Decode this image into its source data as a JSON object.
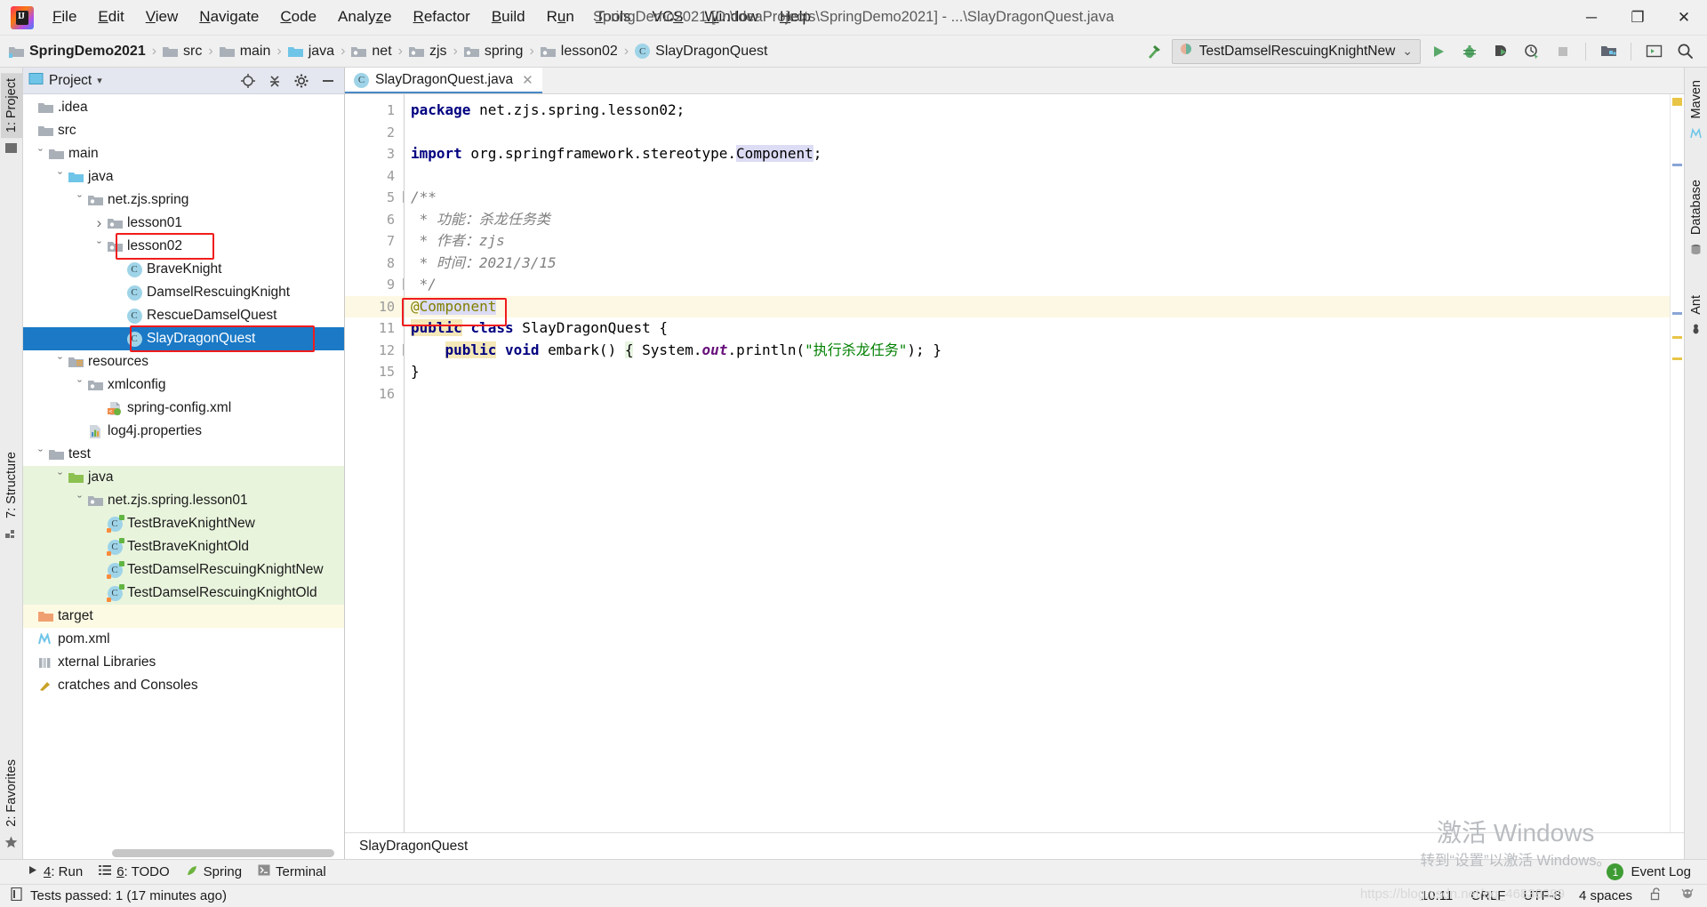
{
  "titlebar": {
    "window_title": "SpringDemo2021 [D:\\IdeaProjects\\SpringDemo2021] - ...\\SlayDragonQuest.java",
    "logo_text": "IJ",
    "menu": [
      {
        "label": "File"
      },
      {
        "label": "Edit"
      },
      {
        "label": "View"
      },
      {
        "label": "Navigate"
      },
      {
        "label": "Code"
      },
      {
        "label": "Analyze"
      },
      {
        "label": "Refactor"
      },
      {
        "label": "Build"
      },
      {
        "label": "Run"
      },
      {
        "label": "Tools"
      },
      {
        "label": "VCS"
      },
      {
        "label": "Window"
      },
      {
        "label": "Help"
      }
    ],
    "minimize": "─",
    "maximize": "❐",
    "close": "✕"
  },
  "navbar": {
    "breadcrumbs": [
      {
        "label": "SpringDemo2021",
        "icon": "project-folder-icon"
      },
      {
        "label": "src",
        "icon": "folder-icon"
      },
      {
        "label": "main",
        "icon": "folder-icon"
      },
      {
        "label": "java",
        "icon": "source-folder-icon"
      },
      {
        "label": "net",
        "icon": "package-icon"
      },
      {
        "label": "zjs",
        "icon": "package-icon"
      },
      {
        "label": "spring",
        "icon": "package-icon"
      },
      {
        "label": "lesson02",
        "icon": "package-icon"
      },
      {
        "label": "SlayDragonQuest",
        "icon": "class-icon"
      }
    ],
    "separator": "›",
    "run_configuration": "TestDamselRescuingKnightNew",
    "run_config_dropdown": "⌄",
    "toolbar_icons": [
      "build-hammer-icon",
      "run-icon",
      "debug-icon",
      "run-coverage-icon",
      "profiler-icon",
      "stop-icon",
      "project-structure-icon",
      "terminal-icon",
      "search-everywhere-icon"
    ]
  },
  "left_strip": {
    "tabs": [
      {
        "label": "1: Project",
        "selected": true
      },
      {
        "label": "7: Structure",
        "selected": false
      },
      {
        "label": "2: Favorites",
        "selected": false
      }
    ]
  },
  "right_strip": {
    "tabs": [
      {
        "label": "Maven"
      },
      {
        "label": "Database"
      },
      {
        "label": "Ant"
      }
    ]
  },
  "project_panel": {
    "title": "Project",
    "dropdown": "▾",
    "header_icons": [
      "locate-target-icon",
      "collapse-all-icon",
      "settings-gear-icon",
      "hide-panel-icon"
    ],
    "tree": [
      {
        "label": ".idea",
        "depth": 0,
        "arrow": "",
        "icon": "folder-icon",
        "color": "#a9b0b8",
        "state": "none"
      },
      {
        "label": "src",
        "depth": 0,
        "arrow": "",
        "icon": "folder-icon",
        "color": "#a9b0b8",
        "state": "none"
      },
      {
        "label": "main",
        "depth": 1,
        "arrow": "ˇ",
        "icon": "folder-icon",
        "color": "#a9b0b8",
        "state": "none"
      },
      {
        "label": "java",
        "depth": 2,
        "arrow": "ˇ",
        "icon": "source-folder-icon",
        "color": "#6fc5e8",
        "state": "none"
      },
      {
        "label": "net.zjs.spring",
        "depth": 3,
        "arrow": "ˇ",
        "icon": "package-icon",
        "color": "#a9b0b8",
        "state": "none"
      },
      {
        "label": "lesson01",
        "depth": 4,
        "arrow": "›",
        "icon": "package-icon",
        "color": "#a9b0b8",
        "state": "none"
      },
      {
        "label": "lesson02",
        "depth": 4,
        "arrow": "ˇ",
        "icon": "package-icon",
        "color": "#a9b0b8",
        "state": "highlight"
      },
      {
        "label": "BraveKnight",
        "depth": 5,
        "arrow": "",
        "icon": "class-icon",
        "color": "#9fd4e8",
        "state": "none"
      },
      {
        "label": "DamselRescuingKnight",
        "depth": 5,
        "arrow": "",
        "icon": "class-icon",
        "color": "#9fd4e8",
        "state": "none"
      },
      {
        "label": "RescueDamselQuest",
        "depth": 5,
        "arrow": "",
        "icon": "class-icon",
        "color": "#9fd4e8",
        "state": "none"
      },
      {
        "label": "SlayDragonQuest",
        "depth": 5,
        "arrow": "",
        "icon": "class-icon",
        "color": "#9fd4e8",
        "state": "selected-highlight"
      },
      {
        "label": "resources",
        "depth": 2,
        "arrow": "ˇ",
        "icon": "resource-folder-icon",
        "color": "#a9b0b8",
        "state": "none"
      },
      {
        "label": "xmlconfig",
        "depth": 3,
        "arrow": "ˇ",
        "icon": "package-icon",
        "color": "#a9b0b8",
        "state": "none"
      },
      {
        "label": "spring-config.xml",
        "depth": 4,
        "arrow": "",
        "icon": "spring-xml-icon",
        "color": "#6db33f",
        "state": "none"
      },
      {
        "label": "log4j.properties",
        "depth": 3,
        "arrow": "",
        "icon": "properties-icon",
        "color": "#e8a33d",
        "state": "none"
      },
      {
        "label": "test",
        "depth": 1,
        "arrow": "ˇ",
        "icon": "folder-icon",
        "color": "#a9b0b8",
        "state": "none"
      },
      {
        "label": "java",
        "depth": 2,
        "arrow": "ˇ",
        "icon": "test-source-folder-icon",
        "color": "#8cc152",
        "state": "green"
      },
      {
        "label": "net.zjs.spring.lesson01",
        "depth": 3,
        "arrow": "ˇ",
        "icon": "package-icon",
        "color": "#a9b0b8",
        "state": "green"
      },
      {
        "label": "TestBraveKnightNew",
        "depth": 4,
        "arrow": "",
        "icon": "test-class-icon",
        "color": "#9fd4e8",
        "state": "green"
      },
      {
        "label": "TestBraveKnightOld",
        "depth": 4,
        "arrow": "",
        "icon": "test-class-icon",
        "color": "#9fd4e8",
        "state": "green"
      },
      {
        "label": "TestDamselRescuingKnightNew",
        "depth": 4,
        "arrow": "",
        "icon": "test-class-icon",
        "color": "#9fd4e8",
        "state": "green"
      },
      {
        "label": "TestDamselRescuingKnightOld",
        "depth": 4,
        "arrow": "",
        "icon": "test-class-icon",
        "color": "#9fd4e8",
        "state": "green"
      },
      {
        "label": "target",
        "depth": 0,
        "arrow": "",
        "icon": "target-folder-icon",
        "color": "#f0a070",
        "state": "yellow"
      },
      {
        "label": "pom.xml",
        "depth": 0,
        "arrow": "",
        "icon": "maven-icon",
        "color": "#6fc5e8",
        "state": "none"
      },
      {
        "label": "xternal Libraries",
        "depth": 0,
        "arrow": "",
        "icon": "libraries-icon",
        "color": "#a9b0b8",
        "state": "none"
      },
      {
        "label": "cratches and Consoles",
        "depth": 0,
        "arrow": "",
        "icon": "scratches-icon",
        "color": "#a9b0b8",
        "state": "none"
      }
    ]
  },
  "editor": {
    "tab": {
      "label": "SlayDragonQuest.java",
      "icon": "class-icon",
      "close": "✕"
    },
    "line_numbers": [
      "1",
      "2",
      "3",
      "4",
      "5",
      "6",
      "7",
      "8",
      "9",
      "10",
      "11",
      "12",
      "15",
      "16"
    ],
    "highlighted_line": "10",
    "breadcrumb_status": "SlayDragonQuest"
  },
  "code": {
    "l1_kw": "package",
    "l1_rest": " net.zjs.spring.lesson02;",
    "l3_kw": "import",
    "l3_a": " org.springframework.stereotype.",
    "l3_hl": "Component",
    "l3_b": ";",
    "l5": "/**",
    "l6": " * 功能：杀龙任务类",
    "l7": " * 作者：zjs",
    "l8": " * 时间：2021/3/15",
    "l9": " */",
    "l10_at": "@",
    "l10_name": "Component",
    "l11_kw1": "public",
    "l11_kw2": "class",
    "l11_rest": " SlayDragonQuest {",
    "l12_kw1": "public",
    "l12_kw2": "void",
    "l12_name": " embark() ",
    "l12_brace": "{",
    "l12_sys": " System.",
    "l12_out": "out",
    "l12_println": ".println(",
    "l12_str": "\"执行杀龙任务\"",
    "l12_end": "); }",
    "l15": "}"
  },
  "bottom_bar": {
    "items": [
      {
        "label": "4: Run",
        "icon": "run-icon",
        "underline": "4"
      },
      {
        "label": "6: TODO",
        "icon": "todo-list-icon",
        "underline": "6"
      },
      {
        "label": "Spring",
        "icon": "spring-leaf-icon",
        "underline": ""
      },
      {
        "label": "Terminal",
        "icon": "terminal-icon",
        "underline": ""
      }
    ],
    "event_log": "Event Log",
    "event_log_count": "1"
  },
  "status_bar": {
    "message": "Tests passed: 1 (17 minutes ago)",
    "message_icon": "test-report-icon",
    "time": "10:11",
    "line_separator": "CRLF",
    "encoding": "UTF-8",
    "indent": "4 spaces",
    "lock_icon": "unlocked-padlock-icon",
    "inspector_icon": "hector-inspection-icon"
  },
  "watermark": {
    "line1": "激活 Windows",
    "line2": "转到“设置”以激活 Windows。",
    "url": "https://blog.csdn.net/qq_46838399"
  },
  "colors": {
    "selection_blue": "#1b79c6",
    "highlight_red": "#f01c1c",
    "test_green_bg": "#e9f4dd",
    "target_yellow_bg": "#fdfae3",
    "caret_line": "#fdf8e3",
    "accent_green": "#3f9c35"
  }
}
